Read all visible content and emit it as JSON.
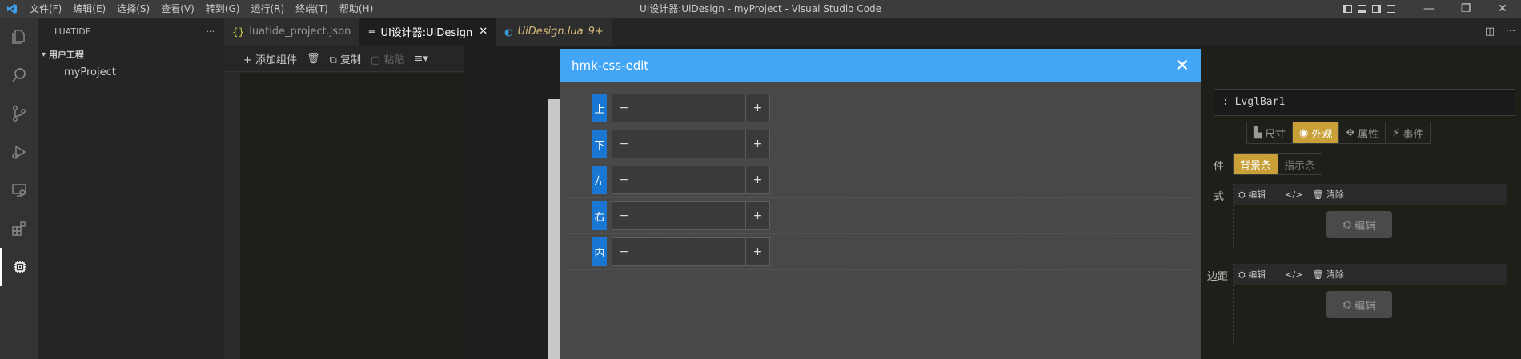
{
  "titlebar": {
    "menus": [
      "文件(F)",
      "编辑(E)",
      "选择(S)",
      "查看(V)",
      "转到(G)",
      "运行(R)",
      "终端(T)",
      "帮助(H)"
    ],
    "window_title": "UI设计器:UiDesign - myProject - Visual Studio Code",
    "minimize": "—",
    "restore": "❐",
    "close": "✕"
  },
  "activitybar": {
    "icons": [
      "explorer-icon",
      "search-icon",
      "source-control-icon",
      "run-debug-icon",
      "remote-explorer-icon",
      "extensions-icon",
      "chip-icon"
    ]
  },
  "sidebar": {
    "header": "LUATIDE",
    "more": "···",
    "section": "用户工程",
    "items": [
      "myProject"
    ]
  },
  "tabs": [
    {
      "icon": "{}",
      "label": "luatide_project.json",
      "active": false
    },
    {
      "icon": "≡",
      "label": "UI设计器:UiDesign",
      "active": true,
      "close": "✕"
    },
    {
      "icon": "◐",
      "label": "UiDesign.lua",
      "badge": "9+",
      "active": false
    }
  ],
  "toolbar": {
    "add": "+ 添加组件",
    "delete": "🗑",
    "copy": "复制",
    "paste": "粘贴",
    "align": "≡▾"
  },
  "right_panel": {
    "name_field": ": LvglBar1",
    "tabs": [
      {
        "icon": "▙",
        "label": "尺寸",
        "active": false
      },
      {
        "icon": "◉",
        "label": "外观",
        "active": true
      },
      {
        "icon": "✥",
        "label": "属性",
        "active": false
      },
      {
        "icon": "⚡",
        "label": "事件",
        "active": false
      }
    ],
    "part_label": "件",
    "subtabs": [
      {
        "label": "背景条",
        "active": true
      },
      {
        "label": "指示条",
        "active": false
      }
    ],
    "sections": [
      {
        "label": "式",
        "edit": "编辑",
        "code": "</>",
        "clear": "清除",
        "button": "编辑"
      },
      {
        "label": "边距",
        "edit": "编辑",
        "code": "</>",
        "clear": "清除",
        "button": "编辑"
      }
    ]
  },
  "modal": {
    "title": "hmk-css-edit",
    "close": "✕",
    "rows": [
      {
        "label": "上",
        "value": ""
      },
      {
        "label": "下",
        "value": ""
      },
      {
        "label": "左",
        "value": ""
      },
      {
        "label": "右",
        "value": ""
      },
      {
        "label": "内",
        "value": ""
      }
    ],
    "minus": "−",
    "plus": "+"
  }
}
